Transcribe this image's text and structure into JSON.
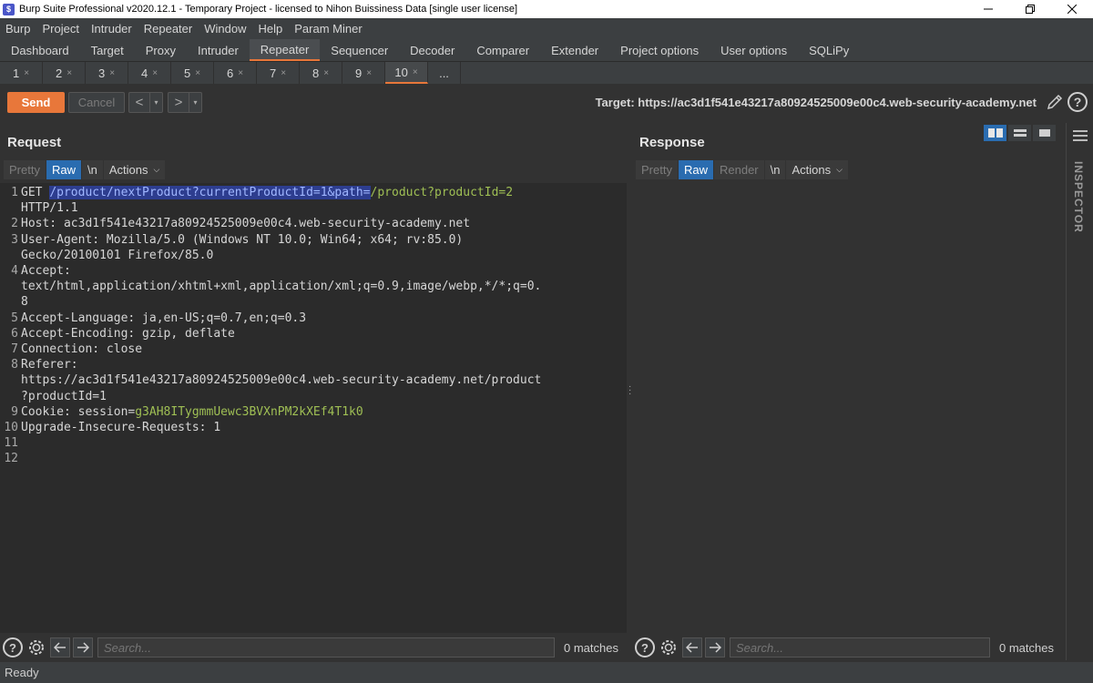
{
  "window": {
    "title": "Burp Suite Professional v2020.12.1 - Temporary Project - licensed to Nihon Buissiness Data [single user license]",
    "app_icon_glyph": "$"
  },
  "menu": [
    "Burp",
    "Project",
    "Intruder",
    "Repeater",
    "Window",
    "Help",
    "Param Miner"
  ],
  "main_tabs": [
    "Dashboard",
    "Target",
    "Proxy",
    "Intruder",
    "Repeater",
    "Sequencer",
    "Decoder",
    "Comparer",
    "Extender",
    "Project options",
    "User options",
    "SQLiPy"
  ],
  "active_main_tab": "Repeater",
  "sub_tabs": [
    "1",
    "2",
    "3",
    "4",
    "5",
    "6",
    "7",
    "8",
    "9",
    "10"
  ],
  "sub_tab_close": "×",
  "sub_tab_more": "...",
  "active_sub_tab": "10",
  "toolbar": {
    "send_label": "Send",
    "cancel_label": "Cancel",
    "back_arrow": "<",
    "forward_arrow": ">",
    "dropdown": "▾",
    "target_text": "Target: https://ac3d1f541e43217a80924525009e00c4.web-security-academy.net",
    "help": "?"
  },
  "request": {
    "title": "Request",
    "view_tabs": [
      "Pretty",
      "Raw",
      "\\n"
    ],
    "active_view": "Raw",
    "actions_label": "Actions",
    "lines": [
      {
        "n": "1",
        "parts": [
          {
            "t": "GET "
          },
          {
            "t": "/product/nextProduct?currentProductId=1&path=",
            "c": "hl"
          },
          {
            "t": "/product?productId=2",
            "c": "green"
          }
        ]
      },
      {
        "n": "",
        "parts": [
          {
            "t": "HTTP/1.1"
          }
        ]
      },
      {
        "n": "2",
        "parts": [
          {
            "t": "Host: ac3d1f541e43217a80924525009e00c4.web-security-academy.net"
          }
        ]
      },
      {
        "n": "3",
        "parts": [
          {
            "t": "User-Agent: Mozilla/5.0 (Windows NT 10.0; Win64; x64; rv:85.0)"
          }
        ]
      },
      {
        "n": "",
        "parts": [
          {
            "t": "Gecko/20100101 Firefox/85.0"
          }
        ]
      },
      {
        "n": "4",
        "parts": [
          {
            "t": "Accept:"
          }
        ]
      },
      {
        "n": "",
        "parts": [
          {
            "t": "text/html,application/xhtml+xml,application/xml;q=0.9,image/webp,*/*;q=0."
          }
        ]
      },
      {
        "n": "",
        "parts": [
          {
            "t": "8"
          }
        ]
      },
      {
        "n": "5",
        "parts": [
          {
            "t": "Accept-Language: ja,en-US;q=0.7,en;q=0.3"
          }
        ]
      },
      {
        "n": "6",
        "parts": [
          {
            "t": "Accept-Encoding: gzip, deflate"
          }
        ]
      },
      {
        "n": "7",
        "parts": [
          {
            "t": "Connection: close"
          }
        ]
      },
      {
        "n": "8",
        "parts": [
          {
            "t": "Referer:"
          }
        ]
      },
      {
        "n": "",
        "parts": [
          {
            "t": "https://ac3d1f541e43217a80924525009e00c4.web-security-academy.net/product"
          }
        ]
      },
      {
        "n": "",
        "parts": [
          {
            "t": "?productId=1"
          }
        ]
      },
      {
        "n": "9",
        "parts": [
          {
            "t": "Cookie: session="
          },
          {
            "t": "g3AH8ITygmmUewc3BVXnPM2kXEf4T1k0",
            "c": "green"
          }
        ]
      },
      {
        "n": "10",
        "parts": [
          {
            "t": "Upgrade-Insecure-Requests: 1"
          }
        ]
      },
      {
        "n": "11",
        "parts": []
      },
      {
        "n": "12",
        "parts": []
      }
    ],
    "search_placeholder": "Search...",
    "matches_text": "0 matches"
  },
  "response": {
    "title": "Response",
    "view_tabs": [
      "Pretty",
      "Raw",
      "Render",
      "\\n"
    ],
    "active_view": "Raw",
    "actions_label": "Actions",
    "search_placeholder": "Search...",
    "matches_text": "0 matches"
  },
  "inspector_label": "INSPECTOR",
  "status_text": "Ready",
  "colors": {
    "accent": "#e8773a",
    "selected_tab": "#2a6cb0",
    "highlight": "#2d3d8f",
    "value_green": "#9fbf54"
  },
  "icons": [
    "app-icon",
    "pencil-icon",
    "help-icon",
    "gear-icon",
    "hamburger-icon",
    "arrow-left-icon",
    "arrow-right-icon"
  ]
}
